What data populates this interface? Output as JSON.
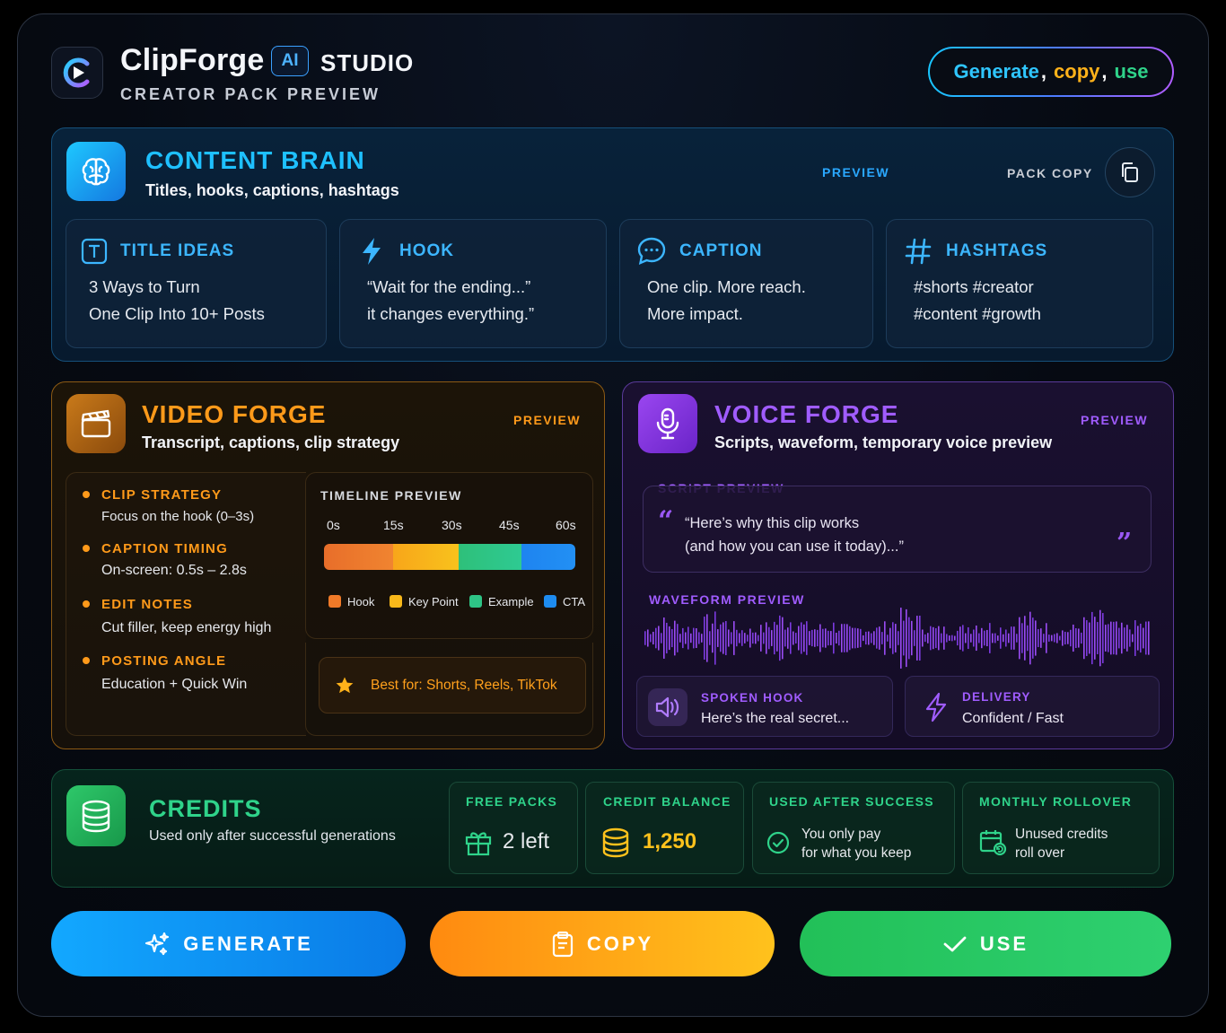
{
  "header": {
    "brand": "ClipForge",
    "ai_badge": "AI",
    "studio": "STUDIO",
    "subtitle": "CREATOR PACK PREVIEW",
    "cta": {
      "generate": "Generate",
      "copy": "copy",
      "use": "use",
      "sep": ","
    }
  },
  "content_brain": {
    "title": "CONTENT BRAIN",
    "subtitle": "Titles, hooks, captions, hashtags",
    "preview": "PREVIEW",
    "pack_copy": "PACK COPY",
    "cards": [
      {
        "title": "TITLE IDEAS",
        "icon": "title-icon",
        "lines": [
          "3 Ways to Turn",
          "One Clip Into 10+ Posts"
        ]
      },
      {
        "title": "HOOK",
        "icon": "lightning-icon",
        "lines": [
          "“Wait for the ending...”",
          "it changes everything.”"
        ]
      },
      {
        "title": "CAPTION",
        "icon": "chat-bubble-icon",
        "lines": [
          "One clip. More reach.",
          "More impact."
        ]
      },
      {
        "title": "HASHTAGS",
        "icon": "hashtag-icon",
        "lines": [
          "#shorts #creator",
          "#content #growth"
        ]
      }
    ]
  },
  "video_forge": {
    "title": "VIDEO FORGE",
    "subtitle": "Transcript, captions, clip strategy",
    "preview": "PREVIEW",
    "items": [
      {
        "title": "CLIP STRATEGY",
        "text": "Focus on the hook (0–3s)"
      },
      {
        "title": "CAPTION TIMING",
        "text": "On-screen: 0.5s – 2.8s"
      },
      {
        "title": "EDIT NOTES",
        "text": "Cut filler, keep energy high"
      },
      {
        "title": "POSTING ANGLE",
        "text": "Education + Quick Win"
      }
    ],
    "timeline": {
      "label": "TIMELINE PREVIEW",
      "ticks": [
        "0s",
        "15s",
        "30s",
        "45s",
        "60s"
      ],
      "segments": [
        {
          "name": "Hook",
          "color": "#f07a28"
        },
        {
          "name": "Key Point",
          "color": "#f8b81a"
        },
        {
          "name": "Example",
          "color": "#2ec486"
        },
        {
          "name": "CTA",
          "color": "#1e8cf0"
        }
      ]
    },
    "best_for": "Best for: Shorts, Reels, TikTok"
  },
  "voice_forge": {
    "title": "VOICE FORGE",
    "subtitle": "Scripts, waveform, temporary voice preview",
    "preview": "PREVIEW",
    "script_label": "SCRIPT PREVIEW",
    "script_lines": [
      "“Here’s why this clip works",
      "(and how you can use it today)...”"
    ],
    "waveform_label": "WAVEFORM PREVIEW",
    "spoken_hook": {
      "title": "SPOKEN HOOK",
      "text": "Here’s the real secret..."
    },
    "delivery": {
      "title": "DELIVERY",
      "text": "Confident / Fast"
    }
  },
  "credits": {
    "title": "CREDITS",
    "subtitle": "Used only after successful generations",
    "free_packs": {
      "title": "FREE PACKS",
      "value": "2 left"
    },
    "credit_balance": {
      "title": "CREDIT BALANCE",
      "value": "1,250"
    },
    "used_after": {
      "title": "USED AFTER SUCCESS",
      "lines": [
        "You only pay",
        "for what you keep"
      ]
    },
    "rollover": {
      "title": "MONTHLY ROLLOVER",
      "lines": [
        "Unused credits",
        "roll over"
      ]
    }
  },
  "actions": {
    "generate": "GENERATE",
    "copy": "COPY",
    "use": "USE"
  },
  "colors": {
    "brain": "#1ec0ff",
    "video": "#ff9a1a",
    "voice": "#a05cff",
    "credits": "#2fd38a"
  }
}
